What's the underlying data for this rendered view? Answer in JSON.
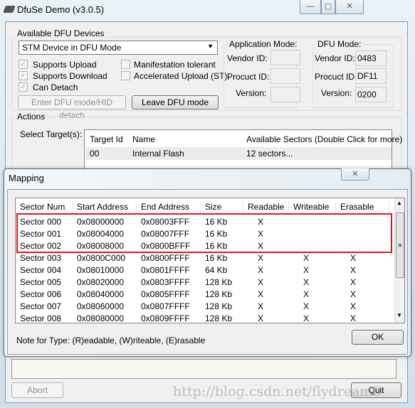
{
  "window": {
    "title": "DfuSe Demo (v3.0.5)",
    "minimize": "—",
    "maximize": "▢",
    "close": "✕"
  },
  "devices": {
    "group_label": "Available DFU Devices",
    "selected": "STM Device in DFU Mode",
    "checks": [
      {
        "label": "Supports Upload",
        "checked": true
      },
      {
        "label": "Supports Download",
        "checked": true
      },
      {
        "label": "Can Detach",
        "checked": true
      },
      {
        "label": "Manifestation tolerant",
        "checked": false
      },
      {
        "label": "Accelerated Upload (ST)",
        "checked": false
      }
    ],
    "enter_button": "Enter DFU mode/HID detach",
    "leave_button": "Leave DFU mode"
  },
  "app_mode": {
    "label": "Application Mode:",
    "vendor_label": "Vendor ID:",
    "product_label": "Procuct ID:",
    "version_label": "Version:",
    "vendor": "",
    "product": "",
    "version": ""
  },
  "dfu_mode": {
    "label": "DFU Mode:",
    "vendor_label": "Vendor ID:",
    "product_label": "Procuct ID:",
    "version_label": "Version:",
    "vendor": "0483",
    "product": "DF11",
    "version": "0200"
  },
  "actions": {
    "label": "Actions",
    "select_target": "Select Target(s):",
    "columns": [
      "Target Id",
      "Name",
      "Available Sectors (Double Click for more)"
    ],
    "rows": [
      [
        "00",
        "Internal Flash",
        "12 sectors..."
      ]
    ],
    "abort": "Abort",
    "quit": "Quit"
  },
  "mapping": {
    "title": "Mapping",
    "close": "✕",
    "columns": [
      "Sector Num",
      "Start Address",
      "End Address",
      "Size",
      "Readable",
      "Writeable",
      "Erasable"
    ],
    "rows": [
      [
        "Sector 000",
        "0x08000000",
        "0x08003FFF",
        "16 Kb",
        "X",
        "",
        ""
      ],
      [
        "Sector 001",
        "0x08004000",
        "0x08007FFF",
        "16 Kb",
        "X",
        "",
        ""
      ],
      [
        "Sector 002",
        "0x08008000",
        "0x0800BFFF",
        "16 Kb",
        "X",
        "",
        ""
      ],
      [
        "Sector 003",
        "0x0800C000",
        "0x0800FFFF",
        "16 Kb",
        "X",
        "X",
        "X"
      ],
      [
        "Sector 004",
        "0x08010000",
        "0x0801FFFF",
        "64 Kb",
        "X",
        "X",
        "X"
      ],
      [
        "Sector 005",
        "0x08020000",
        "0x0803FFFF",
        "128 Kb",
        "X",
        "X",
        "X"
      ],
      [
        "Sector 006",
        "0x08040000",
        "0x0805FFFF",
        "128 Kb",
        "X",
        "X",
        "X"
      ],
      [
        "Sector 007",
        "0x08060000",
        "0x0807FFFF",
        "128 Kb",
        "X",
        "X",
        "X"
      ],
      [
        "Sector 008",
        "0x08080000",
        "0x0809FFFF",
        "128 Kb",
        "X",
        "X",
        "X"
      ]
    ],
    "note": "Note for Type: (R)eadable, (W)riteable, (E)rasable",
    "ok": "OK",
    "highlight_color": "#e8141b"
  },
  "watermark": "http://blog.csdn.net/flydream0"
}
